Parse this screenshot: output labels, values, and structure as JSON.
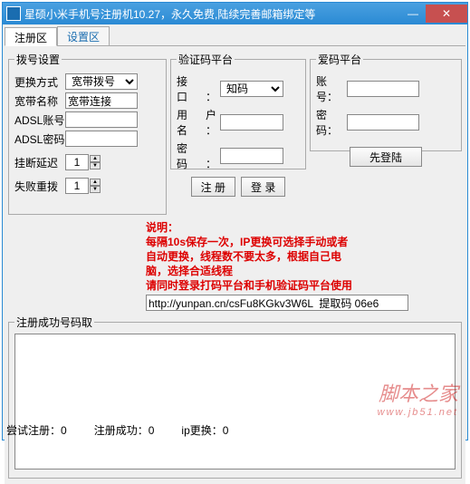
{
  "window": {
    "title": "星硕小米手机号注册机10.27，永久免费,陆续完善邮箱绑定等"
  },
  "tabs": {
    "register": "注册区",
    "settings": "设置区"
  },
  "dial": {
    "legend": "拨号设置",
    "switch_label": "更换方式",
    "switch_value": "宽带拨号",
    "name_label": "宽带名称",
    "name_value": "宽带连接",
    "adsl_user_label": "ADSL账号",
    "adsl_user_value": "",
    "adsl_pass_label": "ADSL密码",
    "adsl_pass_value": "",
    "hangup_label": "挂断延迟",
    "hangup_value": "1",
    "retry_label": "失败重拨",
    "retry_value": "1"
  },
  "verify": {
    "legend": "验证码平台",
    "port_label": "接　口：",
    "port_value": "知码",
    "user_label": "用户名：",
    "user_value": "",
    "pass_label": "密　码：",
    "pass_value": "",
    "btn_register": "注 册",
    "btn_login": "登 录"
  },
  "aima": {
    "legend": "爱码平台",
    "user_label": "账号：",
    "user_value": "",
    "pass_label": "密码：",
    "pass_value": "",
    "btn_login": "先登陆"
  },
  "notice": {
    "title": "说明：",
    "line1": "每隔10s保存一次，IP更换可选择手动或者",
    "line2": "自动更换，线程数不要太多，根据自己电",
    "line3": "脑，选择合适线程",
    "line4": "请同时登录打码平台和手机验证码平台使用"
  },
  "link": {
    "value": "http://yunpan.cn/csFu8KGkv3W6L  提取码 06e6"
  },
  "results": {
    "legend": "注册成功号码取"
  },
  "status": {
    "try_label": "尝试注册：",
    "try_value": "0",
    "ok_label": "注册成功：",
    "ok_value": "0",
    "ip_label": "ip更换：",
    "ip_value": "0"
  },
  "watermark": {
    "main": "脚本之家",
    "sub": "www.jb51.net"
  }
}
